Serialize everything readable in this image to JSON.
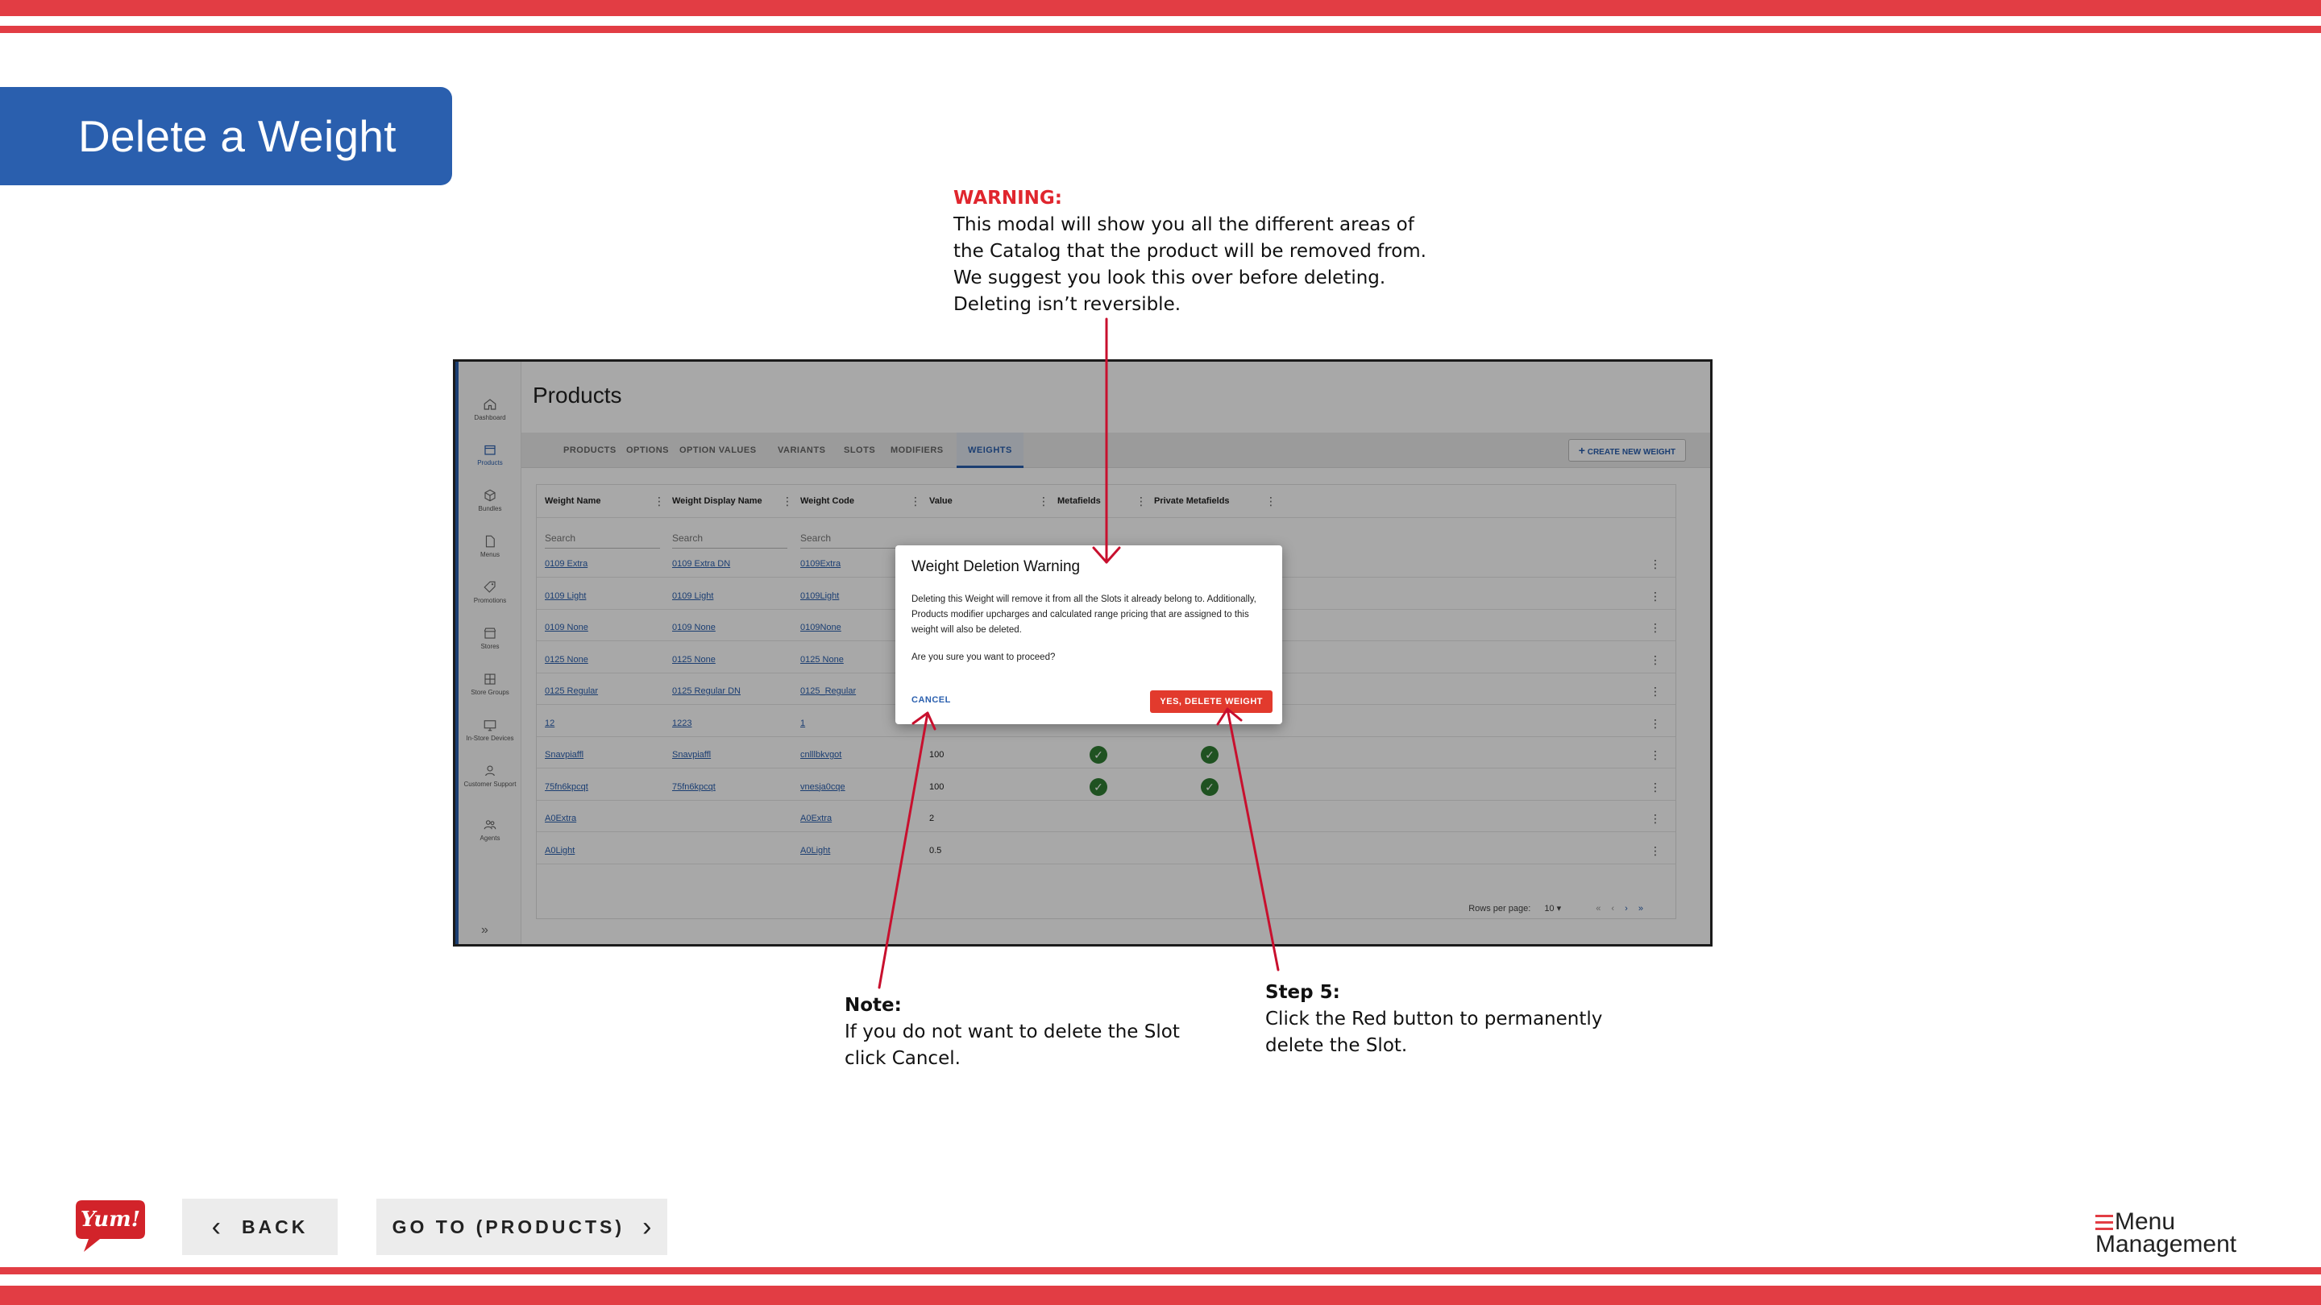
{
  "slide_title": "Delete a Weight",
  "annotations": {
    "warning": {
      "heading": "WARNING:",
      "lines": [
        "This modal will show you all the different areas of",
        "the Catalog that the product will be removed from.",
        "We suggest you look this over before deleting.",
        "Deleting isn’t reversible."
      ]
    },
    "note": {
      "heading": "Note:",
      "lines": [
        "If you do not want to delete the Slot",
        "click Cancel."
      ]
    },
    "step": {
      "heading": "Step 5:",
      "lines": [
        "Click the Red button to permanently",
        "delete the Slot."
      ]
    }
  },
  "app": {
    "page_title": "Products",
    "sidebar": [
      {
        "label": "Dashboard",
        "icon": "home-icon"
      },
      {
        "label": "Products",
        "icon": "box-icon"
      },
      {
        "label": "Bundles",
        "icon": "cube-icon"
      },
      {
        "label": "Menus",
        "icon": "document-icon"
      },
      {
        "label": "Promotions",
        "icon": "tag-icon"
      },
      {
        "label": "Stores",
        "icon": "store-icon"
      },
      {
        "label": "Store Groups",
        "icon": "grid-icon"
      },
      {
        "label": "In-Store Devices",
        "icon": "monitor-icon"
      },
      {
        "label": "Customer Support",
        "icon": "support-icon"
      },
      {
        "label": "Agents",
        "icon": "people-icon"
      }
    ],
    "tabs": [
      "PRODUCTS",
      "OPTIONS",
      "OPTION VALUES",
      "VARIANTS",
      "SLOTS",
      "MODIFIERS",
      "WEIGHTS"
    ],
    "active_tab": "WEIGHTS",
    "create_button": "CREATE NEW WEIGHT",
    "columns": [
      "Weight Name",
      "Weight Display Name",
      "Weight Code",
      "Value",
      "Metafields",
      "Private Metafields"
    ],
    "search_placeholder": "Search",
    "rows": [
      {
        "name": "0109 Extra",
        "display": "0109 Extra DN",
        "code": "0109Extra",
        "value": "",
        "meta": false,
        "pmeta": false
      },
      {
        "name": "0109 Light",
        "display": "0109 Light",
        "code": "0109Light",
        "value": "",
        "meta": false,
        "pmeta": false
      },
      {
        "name": "0109 None",
        "display": "0109 None",
        "code": "0109None",
        "value": "",
        "meta": false,
        "pmeta": false
      },
      {
        "name": "0125 None",
        "display": "0125 None",
        "code": "0125 None",
        "value": "",
        "meta": false,
        "pmeta": false
      },
      {
        "name": "0125 Regular",
        "display": "0125 Regular DN",
        "code": "0125_Regular",
        "value": "",
        "meta": false,
        "pmeta": false
      },
      {
        "name": "12",
        "display": "1223",
        "code": "1",
        "value": "",
        "meta": false,
        "pmeta": false
      },
      {
        "name": "Snavpiaffl",
        "display": "Snavpiaffl",
        "code": "cnlllbkvgot",
        "value": "100",
        "meta": true,
        "pmeta": true
      },
      {
        "name": "75fn6kpcqt",
        "display": "75fn6kpcqt",
        "code": "vnesja0cqe",
        "value": "100",
        "meta": true,
        "pmeta": true
      },
      {
        "name": "A0Extra",
        "display": "",
        "code": "A0Extra",
        "value": "2",
        "meta": false,
        "pmeta": false
      },
      {
        "name": "A0Light",
        "display": "",
        "code": "A0Light",
        "value": "0.5",
        "meta": false,
        "pmeta": false
      }
    ],
    "pagination": {
      "label": "Rows per page:",
      "value": "10"
    },
    "modal": {
      "title": "Weight Deletion Warning",
      "body": "Deleting this Weight will remove it from all the Slots it already belong to. Additionally, Products modifier upcharges and calculated range pricing that are assigned to this weight will also be deleted.",
      "question": "Are you sure you want to proceed?",
      "cancel": "CANCEL",
      "confirm": "YES, DELETE WEIGHT"
    }
  },
  "navigation": {
    "back": "BACK",
    "forward": "GO TO (PRODUCTS)"
  },
  "logos": {
    "yum": "Yum!",
    "menu_management_line1": "Menu",
    "menu_management_line2": "Management"
  },
  "colors": {
    "accent_red": "#e23d44",
    "brand_blue": "#2a5fae",
    "confirm_red": "#e23a2d",
    "check_green": "#2f7d32"
  }
}
